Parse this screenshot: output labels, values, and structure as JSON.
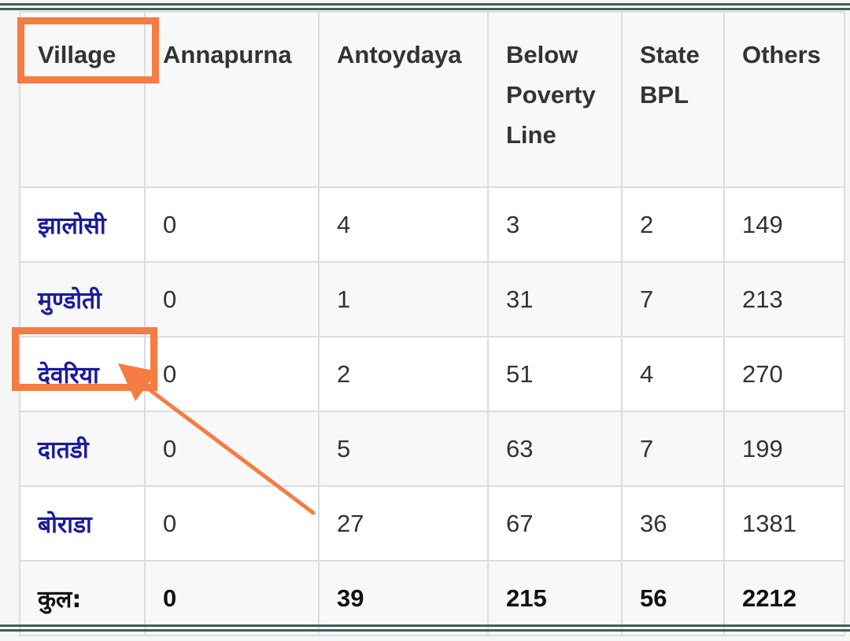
{
  "table": {
    "headers": [
      "Village",
      "Annapurna",
      "Antoydaya",
      "Below Poverty Line",
      "State BPL",
      "Others"
    ],
    "rows": [
      {
        "village": "झालोसी",
        "annapurna": "0",
        "antoydaya": "4",
        "bpl": "3",
        "state_bpl": "2",
        "others": "149"
      },
      {
        "village": "मुण्डोती",
        "annapurna": "0",
        "antoydaya": "1",
        "bpl": "31",
        "state_bpl": "7",
        "others": "213"
      },
      {
        "village": "देवरिया",
        "annapurna": "0",
        "antoydaya": "2",
        "bpl": "51",
        "state_bpl": "4",
        "others": "270"
      },
      {
        "village": "दातडी",
        "annapurna": "0",
        "antoydaya": "5",
        "bpl": "63",
        "state_bpl": "7",
        "others": "199"
      },
      {
        "village": "बोराडा",
        "annapurna": "0",
        "antoydaya": "27",
        "bpl": "67",
        "state_bpl": "36",
        "others": "1381"
      }
    ],
    "totals": {
      "label": "कुल:",
      "annapurna": "0",
      "antoydaya": "39",
      "bpl": "215",
      "state_bpl": "56",
      "others": "2212"
    }
  },
  "annotations": {
    "highlight_color": "#f57c42",
    "highlighted_header": "Village",
    "highlighted_village": "देवरिया",
    "arrow_target": "देवरिया"
  },
  "colors": {
    "link": "#1a1aa0",
    "rule": "#3f5f5a",
    "border": "#dcdcdc"
  }
}
